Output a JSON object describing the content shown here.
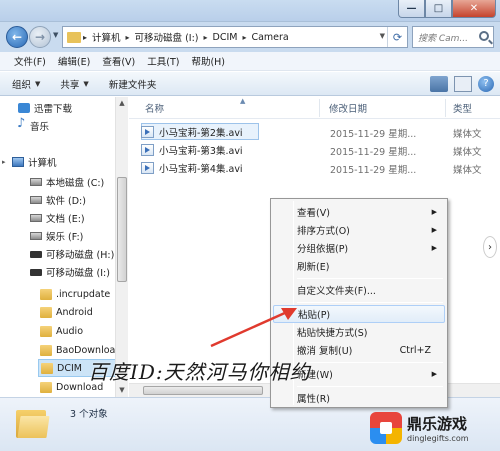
{
  "window": {
    "min_label": "—",
    "max_label": "□",
    "close_label": "✕"
  },
  "address": {
    "crumbs": [
      "计算机",
      "可移动磁盘 (I:)",
      "DCIM",
      "Camera"
    ],
    "search_placeholder": "搜索 Cam..."
  },
  "menubar": [
    "文件(F)",
    "编辑(E)",
    "查看(V)",
    "工具(T)",
    "帮助(H)"
  ],
  "toolbar": {
    "organize": "组织",
    "share": "共享",
    "new_folder": "新建文件夹"
  },
  "nav": {
    "favorites": [
      {
        "label": "迅雷下载"
      },
      {
        "label": "音乐"
      }
    ],
    "computer": "计算机",
    "drives": [
      {
        "label": "本地磁盘 (C:)"
      },
      {
        "label": "软件 (D:)"
      },
      {
        "label": "文档 (E:)"
      },
      {
        "label": "娱乐 (F:)"
      },
      {
        "label": "可移动磁盘 (H:)"
      },
      {
        "label": "可移动磁盘 (I:)"
      }
    ],
    "folders": [
      {
        "label": ".incrupdate"
      },
      {
        "label": "Android"
      },
      {
        "label": "Audio"
      },
      {
        "label": "BaoDownload"
      },
      {
        "label": "DCIM"
      },
      {
        "label": "Download"
      }
    ]
  },
  "columns": {
    "name": "名称",
    "date": "修改日期",
    "type": "类型"
  },
  "files": [
    {
      "name": "小马宝莉-第2集.avi",
      "date": "2015-11-29 星期...",
      "type": "媒体文"
    },
    {
      "name": "小马宝莉-第3集.avi",
      "date": "2015-11-29 星期...",
      "type": "媒体文"
    },
    {
      "name": "小马宝莉-第4集.avi",
      "date": "2015-11-29 星期...",
      "type": "媒体文"
    }
  ],
  "context_menu": [
    {
      "label": "查看(V)",
      "submenu": true
    },
    {
      "label": "排序方式(O)",
      "submenu": true
    },
    {
      "label": "分组依据(P)",
      "submenu": true
    },
    {
      "label": "刷新(E)"
    },
    {
      "label": "自定义文件夹(F)..."
    },
    {
      "label": "粘贴(P)",
      "highlighted": true
    },
    {
      "label": "粘贴快捷方式(S)"
    },
    {
      "label": "撤消 复制(U)",
      "shortcut": "Ctrl+Z"
    },
    {
      "label": "新建(W)",
      "submenu": true
    },
    {
      "label": "属性(R)"
    }
  ],
  "status": {
    "count": "3 个对象"
  },
  "watermark": "百度ID:天然河马你相约",
  "logo": {
    "name": "鼎乐游戏",
    "url": "dinglegifts.com"
  },
  "colors": {
    "accent": "#3a87d5",
    "arrow": "#e03a2e"
  }
}
